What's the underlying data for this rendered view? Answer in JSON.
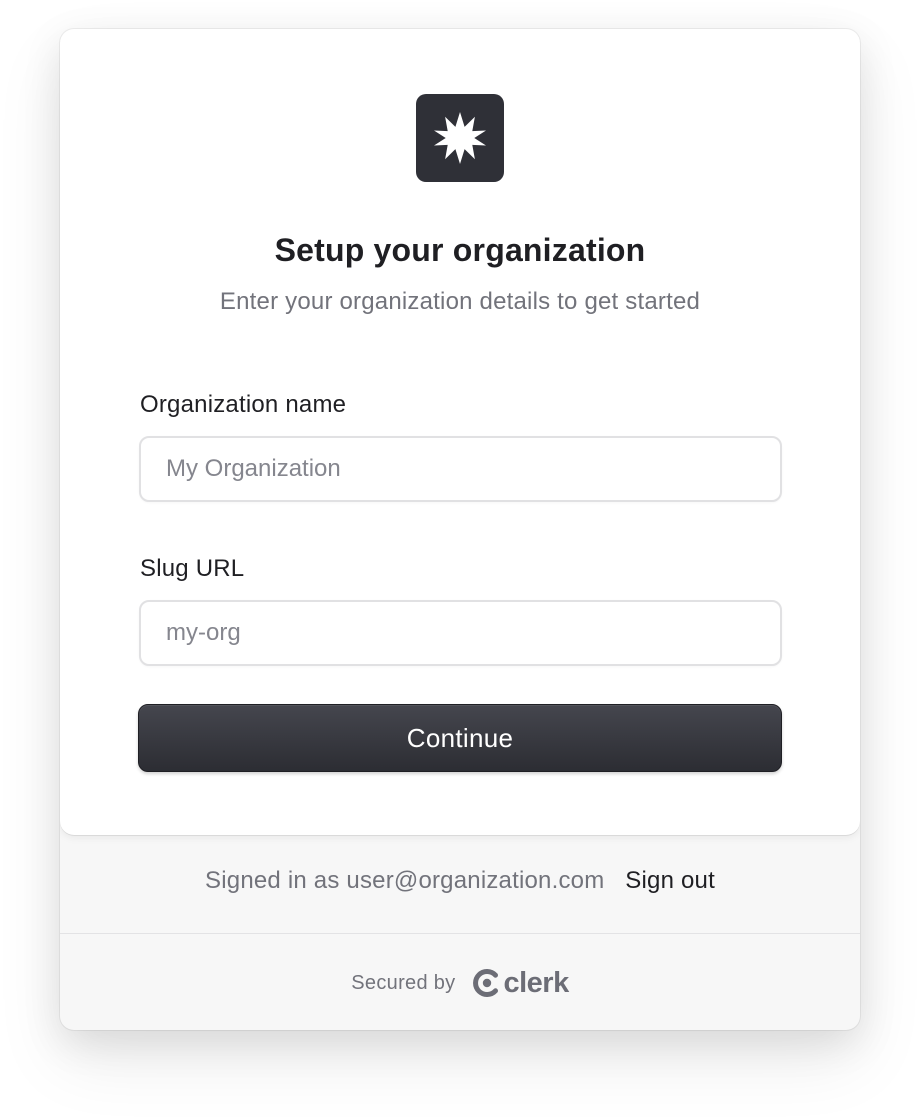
{
  "header": {
    "logo_icon": "starburst-icon",
    "title": "Setup your organization",
    "subtitle": "Enter your organization details to get started"
  },
  "form": {
    "org_name": {
      "label": "Organization name",
      "placeholder": "My Organization",
      "value": ""
    },
    "slug": {
      "label": "Slug URL",
      "placeholder": "my-org",
      "value": ""
    },
    "submit_label": "Continue"
  },
  "footer": {
    "signed_in_text": "Signed in as user@organization.com",
    "sign_out_label": "Sign out",
    "secured_by": "Secured by",
    "brand": "clerk",
    "brand_icon": "clerk-logo-icon"
  },
  "colors": {
    "primary": "#2f3037",
    "text": "#1f1f23",
    "muted": "#72737b",
    "footer_bg": "#f7f7f7"
  }
}
